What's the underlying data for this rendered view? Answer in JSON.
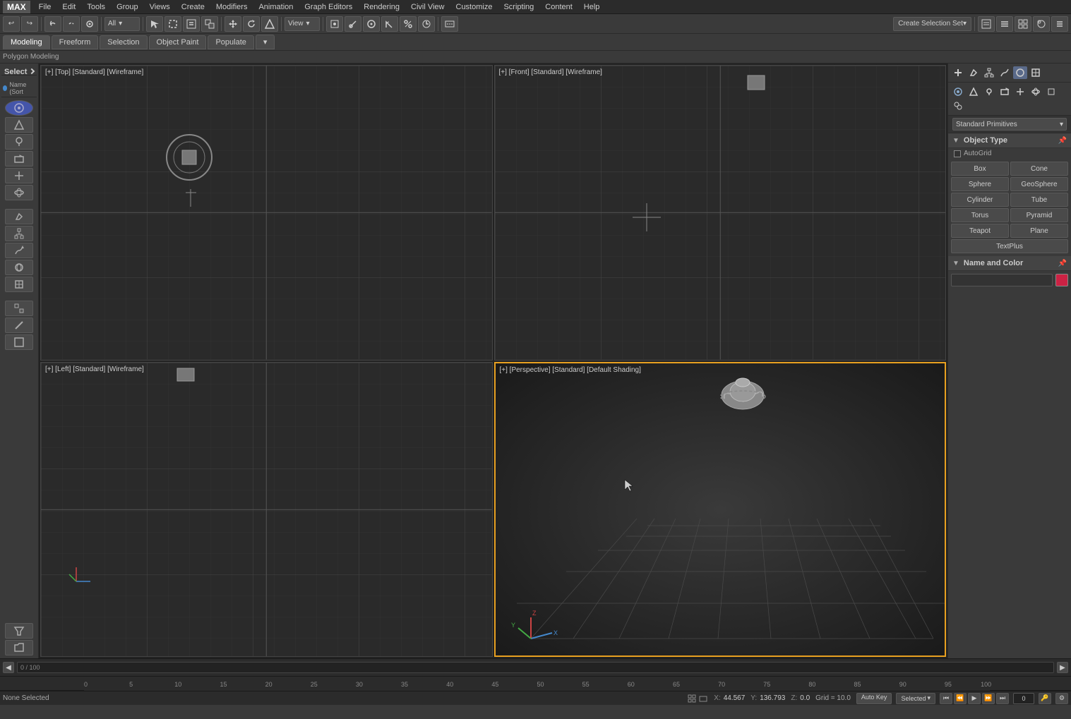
{
  "menubar": {
    "logo": "MAX",
    "items": [
      "File",
      "Edit",
      "Tools",
      "Group",
      "Views",
      "Create",
      "Modifiers",
      "Animation",
      "Graph Editors",
      "Rendering",
      "Civil View",
      "Customize",
      "Scripting",
      "Content",
      "Help"
    ]
  },
  "toolbar1": {
    "filter_label": "All",
    "view_label": "View",
    "create_selection": "Create Selection Set",
    "create_selection_arrow": "▾"
  },
  "tabs": {
    "items": [
      "Modeling",
      "Freeform",
      "Selection",
      "Object Paint",
      "Populate",
      "▾"
    ],
    "active": "Modeling"
  },
  "breadcrumb": "Polygon Modeling",
  "scene_panel": {
    "select_label": "Select",
    "name_sort": "Name (Sort"
  },
  "viewports": {
    "top": {
      "label": "[+] [Top] [Standard] [Wireframe]"
    },
    "front": {
      "label": "[+] [Front] [Standard] [Wireframe]"
    },
    "left": {
      "label": "[+] [Left] [Standard] [Wireframe]"
    },
    "perspective": {
      "label": "[+] [Perspective] [Standard] [Default Shading]",
      "active": true
    }
  },
  "right_panel": {
    "dropdown_label": "Standard Primitives",
    "dropdown_arrow": "▾",
    "section_object_type": "Object Type",
    "autogrid": "AutoGrid",
    "buttons": [
      "Box",
      "Cone",
      "Sphere",
      "GeoSphere",
      "Cylinder",
      "Tube",
      "Torus",
      "Pyramid",
      "Teapot",
      "Plane",
      "TextPlus"
    ],
    "section_name_color": "Name and Color",
    "color_swatch": "#cc2244"
  },
  "timeline": {
    "counter": "0 / 100",
    "prev_arrow": "◀",
    "next_arrow": "▶"
  },
  "ruler": {
    "ticks": [
      "0",
      "5",
      "10",
      "15",
      "20",
      "25",
      "30",
      "35",
      "40",
      "45",
      "50",
      "55",
      "60",
      "65",
      "70",
      "75",
      "80",
      "85",
      "90",
      "95",
      "100"
    ]
  },
  "status_bar": {
    "none_selected": "None Selected",
    "x_label": "X:",
    "x_value": "44.567",
    "y_label": "Y:",
    "y_value": "136.793",
    "z_label": "Z:",
    "z_value": "0.0",
    "grid_label": "Grid = 10.0",
    "auto_key": "Auto Key",
    "selected": "Selected",
    "selected_dropdown": "▾"
  },
  "icons": {
    "undo": "↩",
    "redo": "↪",
    "link": "⛓",
    "unlink": "⛓",
    "bind": "⊕",
    "select_filter": "▦",
    "select": "↖",
    "select_region": "⬚",
    "move": "✛",
    "rotate": "↻",
    "scale": "⤢",
    "mirror": "⟺",
    "align": "⊟",
    "snap": "⊞",
    "snap_toggle": "⊡",
    "angle_snap": "∠",
    "percent": "%",
    "spinner": "⊕",
    "keyboard": "⌨",
    "camera": "⊞",
    "layers": "≡",
    "help": "?",
    "plus": "+",
    "minus": "-",
    "settings": "⚙"
  }
}
